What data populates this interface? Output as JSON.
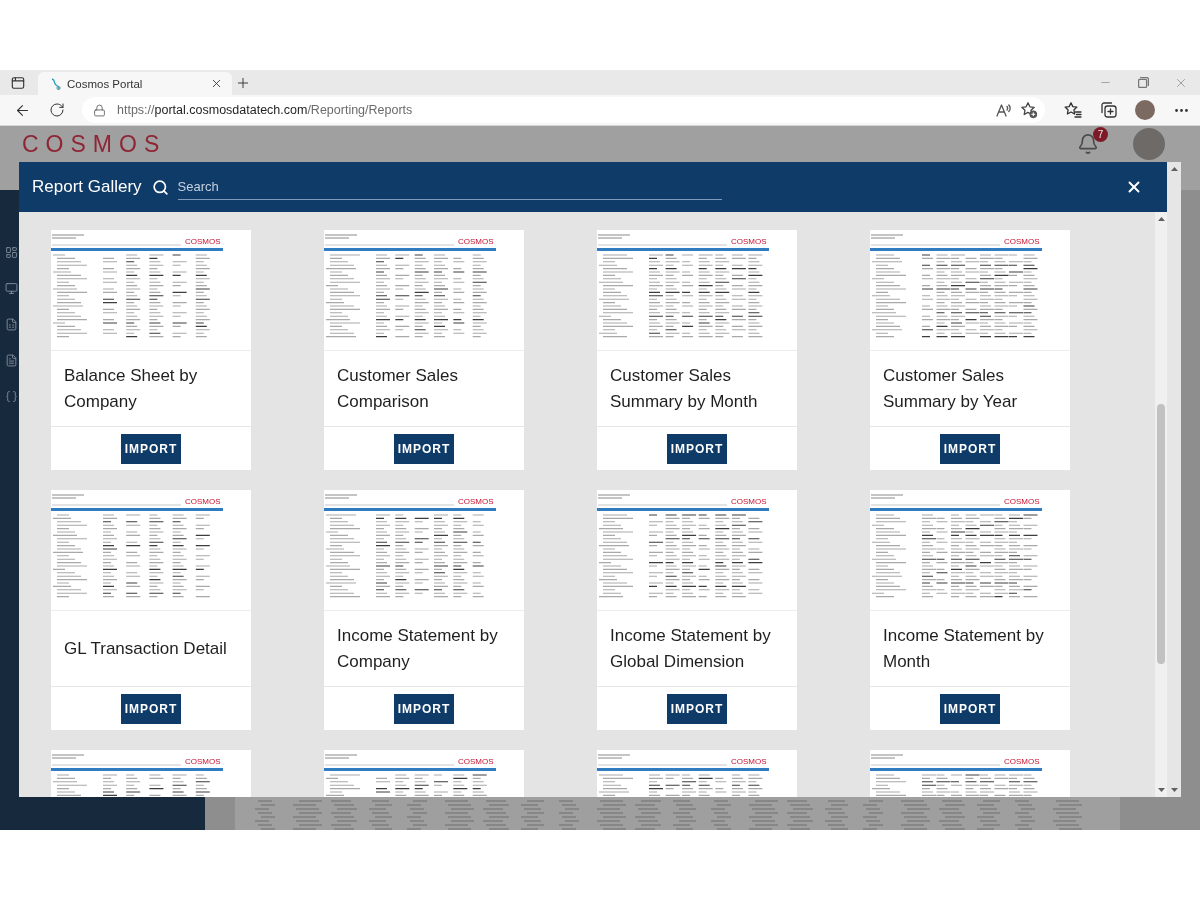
{
  "browser": {
    "tab": {
      "title": "Cosmos Portal"
    },
    "address": {
      "scheme": "https://",
      "host": "portal.cosmosdatatech.com",
      "path": "/Reporting/Reports"
    }
  },
  "page": {
    "logo": "COSMOS",
    "notifications": {
      "count": "7"
    }
  },
  "dialog": {
    "title": "Report Gallery",
    "search": {
      "placeholder": "Search"
    },
    "cards": [
      {
        "title": "Balance Sheet by Company",
        "logo": "COSMOS",
        "button": "IMPORT"
      },
      {
        "title": "Customer Sales Comparison",
        "logo": "COSMOS",
        "button": "IMPORT"
      },
      {
        "title": "Customer Sales Summary by Month",
        "logo": "COSMOS",
        "button": "IMPORT"
      },
      {
        "title": "Customer Sales Summary by Year",
        "logo": "COSMOS",
        "button": "IMPORT"
      },
      {
        "title": "GL Transaction Detail",
        "logo": "COSMOS",
        "button": "IMPORT"
      },
      {
        "title": "Income Statement by Company",
        "logo": "COSMOS",
        "button": "IMPORT"
      },
      {
        "title": "Income Statement by Global Dimension",
        "logo": "COSMOS",
        "button": "IMPORT"
      },
      {
        "title": "Income Statement by Month",
        "logo": "COSMOS",
        "button": "IMPORT"
      },
      {
        "logo": "COSMOS"
      },
      {
        "logo": "COSMOS"
      },
      {
        "logo": "COSMOS"
      },
      {
        "logo": "COSMOS"
      }
    ]
  }
}
